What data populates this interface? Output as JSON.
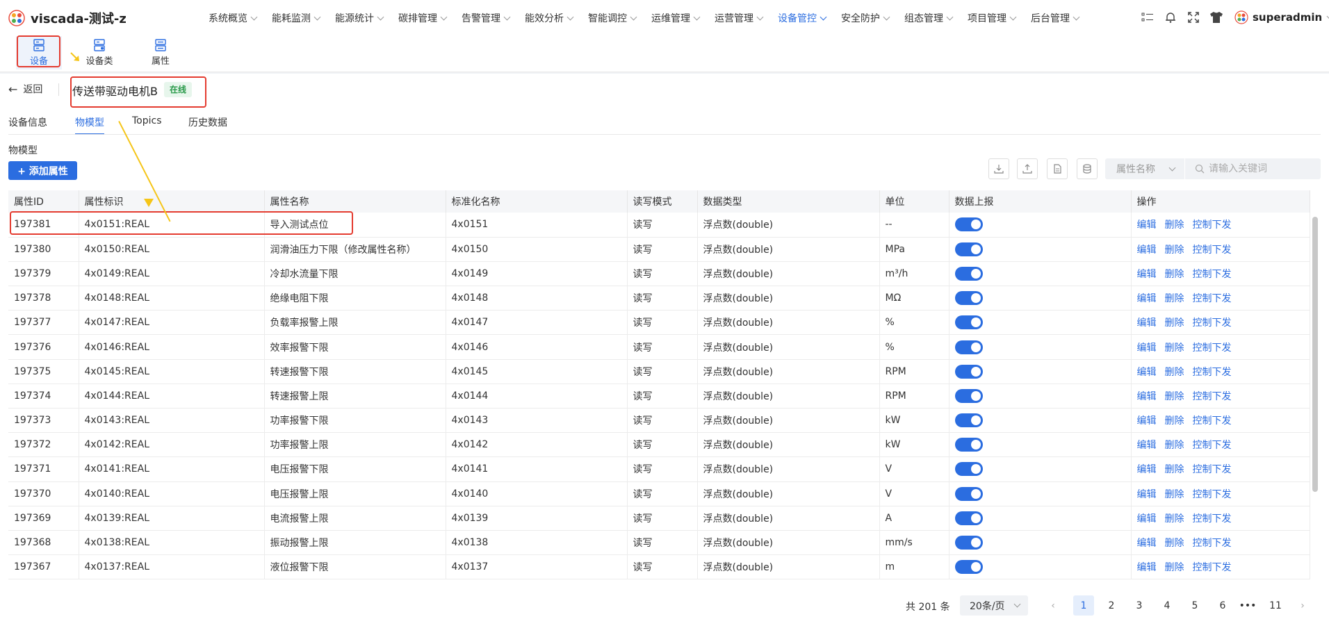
{
  "app": {
    "title": "viscada-测试-z"
  },
  "nav": [
    {
      "label": "系统概览"
    },
    {
      "label": "能耗监测"
    },
    {
      "label": "能源统计"
    },
    {
      "label": "碳排管理"
    },
    {
      "label": "告警管理"
    },
    {
      "label": "能效分析"
    },
    {
      "label": "智能调控"
    },
    {
      "label": "运维管理"
    },
    {
      "label": "运营管理"
    },
    {
      "label": "设备管控",
      "active": true
    },
    {
      "label": "安全防护"
    },
    {
      "label": "组态管理"
    },
    {
      "label": "项目管理"
    },
    {
      "label": "后台管理"
    }
  ],
  "user": {
    "name": "superadmin"
  },
  "subtabs": [
    {
      "label": "设备",
      "active": true
    },
    {
      "label": "设备类"
    },
    {
      "label": "属性"
    }
  ],
  "device": {
    "back_label": "返回",
    "name": "传送带驱动电机B",
    "status": "在线"
  },
  "tabs": [
    {
      "label": "设备信息"
    },
    {
      "label": "物模型",
      "active": true
    },
    {
      "label": "Topics"
    },
    {
      "label": "历史数据"
    }
  ],
  "section": {
    "title": "物模型",
    "add_label": "+ 添加属性"
  },
  "filter": {
    "select_placeholder": "属性名称",
    "search_placeholder": "请输入关键词"
  },
  "table": {
    "columns": [
      "属性ID",
      "属性标识",
      "属性名称",
      "标准化名称",
      "读写模式",
      "数据类型",
      "单位",
      "数据上报",
      "操作"
    ],
    "actions": [
      "编辑",
      "删除",
      "控制下发"
    ],
    "rows": [
      [
        "197381",
        "4x0151:REAL",
        "导入测试点位",
        "4x0151",
        "读写",
        "浮点数(double)",
        "--"
      ],
      [
        "197380",
        "4x0150:REAL",
        "润滑油压力下限（修改属性名称）",
        "4x0150",
        "读写",
        "浮点数(double)",
        "MPa"
      ],
      [
        "197379",
        "4x0149:REAL",
        "冷却水流量下限",
        "4x0149",
        "读写",
        "浮点数(double)",
        "m³/h"
      ],
      [
        "197378",
        "4x0148:REAL",
        "绝缘电阻下限",
        "4x0148",
        "读写",
        "浮点数(double)",
        "MΩ"
      ],
      [
        "197377",
        "4x0147:REAL",
        "负载率报警上限",
        "4x0147",
        "读写",
        "浮点数(double)",
        "%"
      ],
      [
        "197376",
        "4x0146:REAL",
        "效率报警下限",
        "4x0146",
        "读写",
        "浮点数(double)",
        "%"
      ],
      [
        "197375",
        "4x0145:REAL",
        "转速报警下限",
        "4x0145",
        "读写",
        "浮点数(double)",
        "RPM"
      ],
      [
        "197374",
        "4x0144:REAL",
        "转速报警上限",
        "4x0144",
        "读写",
        "浮点数(double)",
        "RPM"
      ],
      [
        "197373",
        "4x0143:REAL",
        "功率报警下限",
        "4x0143",
        "读写",
        "浮点数(double)",
        "kW"
      ],
      [
        "197372",
        "4x0142:REAL",
        "功率报警上限",
        "4x0142",
        "读写",
        "浮点数(double)",
        "kW"
      ],
      [
        "197371",
        "4x0141:REAL",
        "电压报警下限",
        "4x0141",
        "读写",
        "浮点数(double)",
        "V"
      ],
      [
        "197370",
        "4x0140:REAL",
        "电压报警上限",
        "4x0140",
        "读写",
        "浮点数(double)",
        "V"
      ],
      [
        "197369",
        "4x0139:REAL",
        "电流报警上限",
        "4x0139",
        "读写",
        "浮点数(double)",
        "A"
      ],
      [
        "197368",
        "4x0138:REAL",
        "振动报警上限",
        "4x0138",
        "读写",
        "浮点数(double)",
        "mm/s"
      ],
      [
        "197367",
        "4x0137:REAL",
        "液位报警下限",
        "4x0137",
        "读写",
        "浮点数(double)",
        "m"
      ]
    ]
  },
  "pagination": {
    "total": "共 201 条",
    "page_size": "20条/页",
    "pages": [
      "1",
      "2",
      "3",
      "4",
      "5",
      "6",
      "•••",
      "11"
    ],
    "current": "1"
  }
}
